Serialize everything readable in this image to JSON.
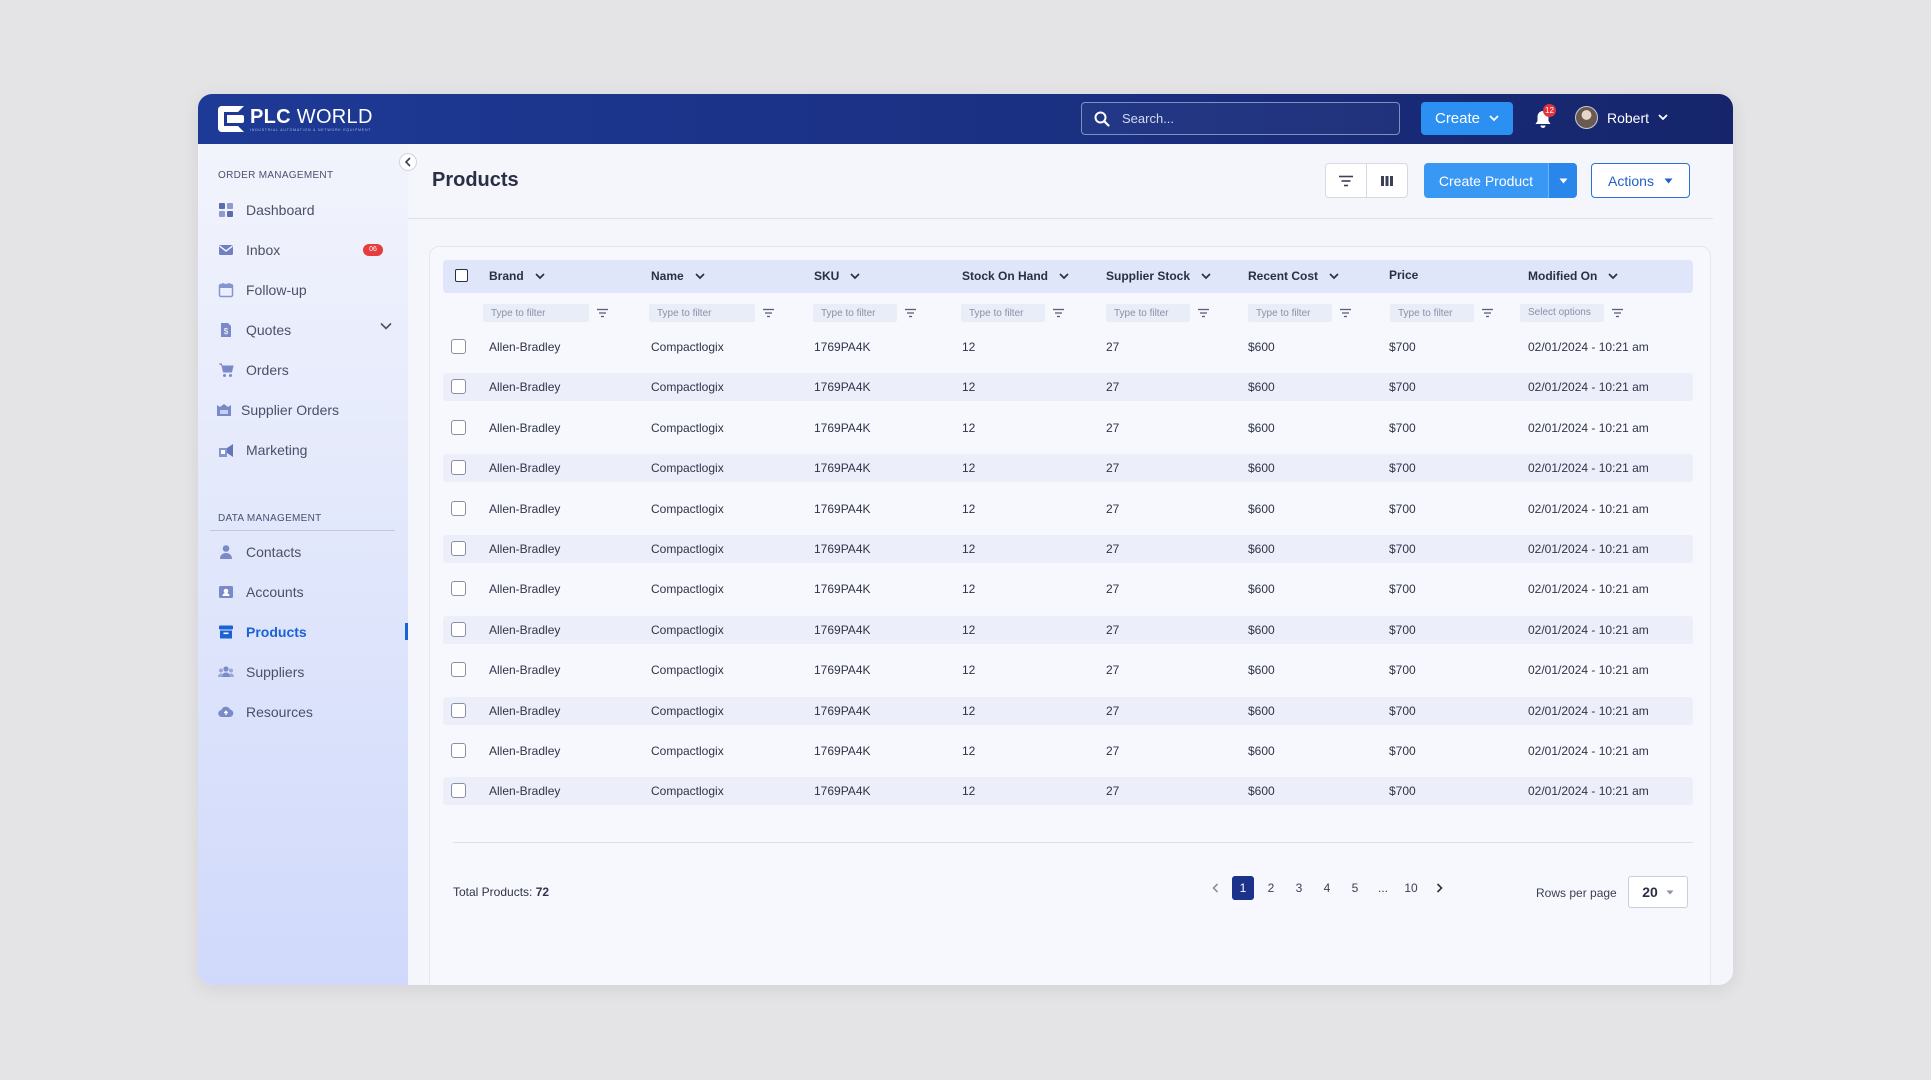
{
  "brand": {
    "name_bold": "PLC",
    "name_light": "WORLD",
    "tagline": "INDUSTRIAL AUTOMATION & NETWORK EQUIPMENT"
  },
  "topbar": {
    "search_placeholder": "Search...",
    "create_label": "Create",
    "notification_count": "12",
    "user_name": "Robert"
  },
  "sidebar": {
    "section1_label": "ORDER MANAGEMENT",
    "section1_items": [
      {
        "label": "Dashboard",
        "icon": "dashboard-icon"
      },
      {
        "label": "Inbox",
        "icon": "mail-icon",
        "badge": "06"
      },
      {
        "label": "Follow-up",
        "icon": "calendar-icon"
      },
      {
        "label": "Quotes",
        "icon": "quote-icon"
      },
      {
        "label": "Orders",
        "icon": "cart-icon"
      },
      {
        "label": "Supplier Orders",
        "icon": "supplier-orders-icon"
      },
      {
        "label": "Marketing",
        "icon": "marketing-icon"
      }
    ],
    "section2_label": "DATA MANAGEMENT",
    "section2_items": [
      {
        "label": "Contacts",
        "icon": "contact-icon"
      },
      {
        "label": "Accounts",
        "icon": "account-icon"
      },
      {
        "label": "Products",
        "icon": "products-icon",
        "active": true
      },
      {
        "label": "Suppliers",
        "icon": "suppliers-icon"
      },
      {
        "label": "Resources",
        "icon": "cloud-icon"
      }
    ]
  },
  "page": {
    "title": "Products",
    "create_product_label": "Create Product",
    "actions_label": "Actions"
  },
  "table": {
    "columns": [
      "Brand",
      "Name",
      "SKU",
      "Stock On Hand",
      "Supplier Stock",
      "Recent Cost",
      "Price",
      "Modified On"
    ],
    "filter_placeholder": "Type to filter",
    "select_placeholder": "Select options",
    "rows": [
      [
        "Allen-Bradley",
        "Compactlogix",
        "1769PA4K",
        "12",
        "27",
        "$600",
        "$700",
        "02/01/2024 - 10:21 am"
      ],
      [
        "Allen-Bradley",
        "Compactlogix",
        "1769PA4K",
        "12",
        "27",
        "$600",
        "$700",
        "02/01/2024 - 10:21 am"
      ],
      [
        "Allen-Bradley",
        "Compactlogix",
        "1769PA4K",
        "12",
        "27",
        "$600",
        "$700",
        "02/01/2024 - 10:21 am"
      ],
      [
        "Allen-Bradley",
        "Compactlogix",
        "1769PA4K",
        "12",
        "27",
        "$600",
        "$700",
        "02/01/2024 - 10:21 am"
      ],
      [
        "Allen-Bradley",
        "Compactlogix",
        "1769PA4K",
        "12",
        "27",
        "$600",
        "$700",
        "02/01/2024 - 10:21 am"
      ],
      [
        "Allen-Bradley",
        "Compactlogix",
        "1769PA4K",
        "12",
        "27",
        "$600",
        "$700",
        "02/01/2024 - 10:21 am"
      ],
      [
        "Allen-Bradley",
        "Compactlogix",
        "1769PA4K",
        "12",
        "27",
        "$600",
        "$700",
        "02/01/2024 - 10:21 am"
      ],
      [
        "Allen-Bradley",
        "Compactlogix",
        "1769PA4K",
        "12",
        "27",
        "$600",
        "$700",
        "02/01/2024 - 10:21 am"
      ],
      [
        "Allen-Bradley",
        "Compactlogix",
        "1769PA4K",
        "12",
        "27",
        "$600",
        "$700",
        "02/01/2024 - 10:21 am"
      ],
      [
        "Allen-Bradley",
        "Compactlogix",
        "1769PA4K",
        "12",
        "27",
        "$600",
        "$700",
        "02/01/2024 - 10:21 am"
      ],
      [
        "Allen-Bradley",
        "Compactlogix",
        "1769PA4K",
        "12",
        "27",
        "$600",
        "$700",
        "02/01/2024 - 10:21 am"
      ],
      [
        "Allen-Bradley",
        "Compactlogix",
        "1769PA4K",
        "12",
        "27",
        "$600",
        "$700",
        "02/01/2024 - 10:21 am"
      ]
    ]
  },
  "footer": {
    "total_label": "Total Products:",
    "total_value": "72",
    "pages": [
      "1",
      "2",
      "3",
      "4",
      "5",
      "...",
      "10"
    ],
    "current_page": "1",
    "rows_per_page_label": "Rows per page",
    "rows_per_page_value": "20"
  },
  "colors": {
    "topbar": "#1a2f80",
    "accent": "#2b90f2",
    "active_nav": "#1a62d6",
    "badge": "#e3323b"
  }
}
